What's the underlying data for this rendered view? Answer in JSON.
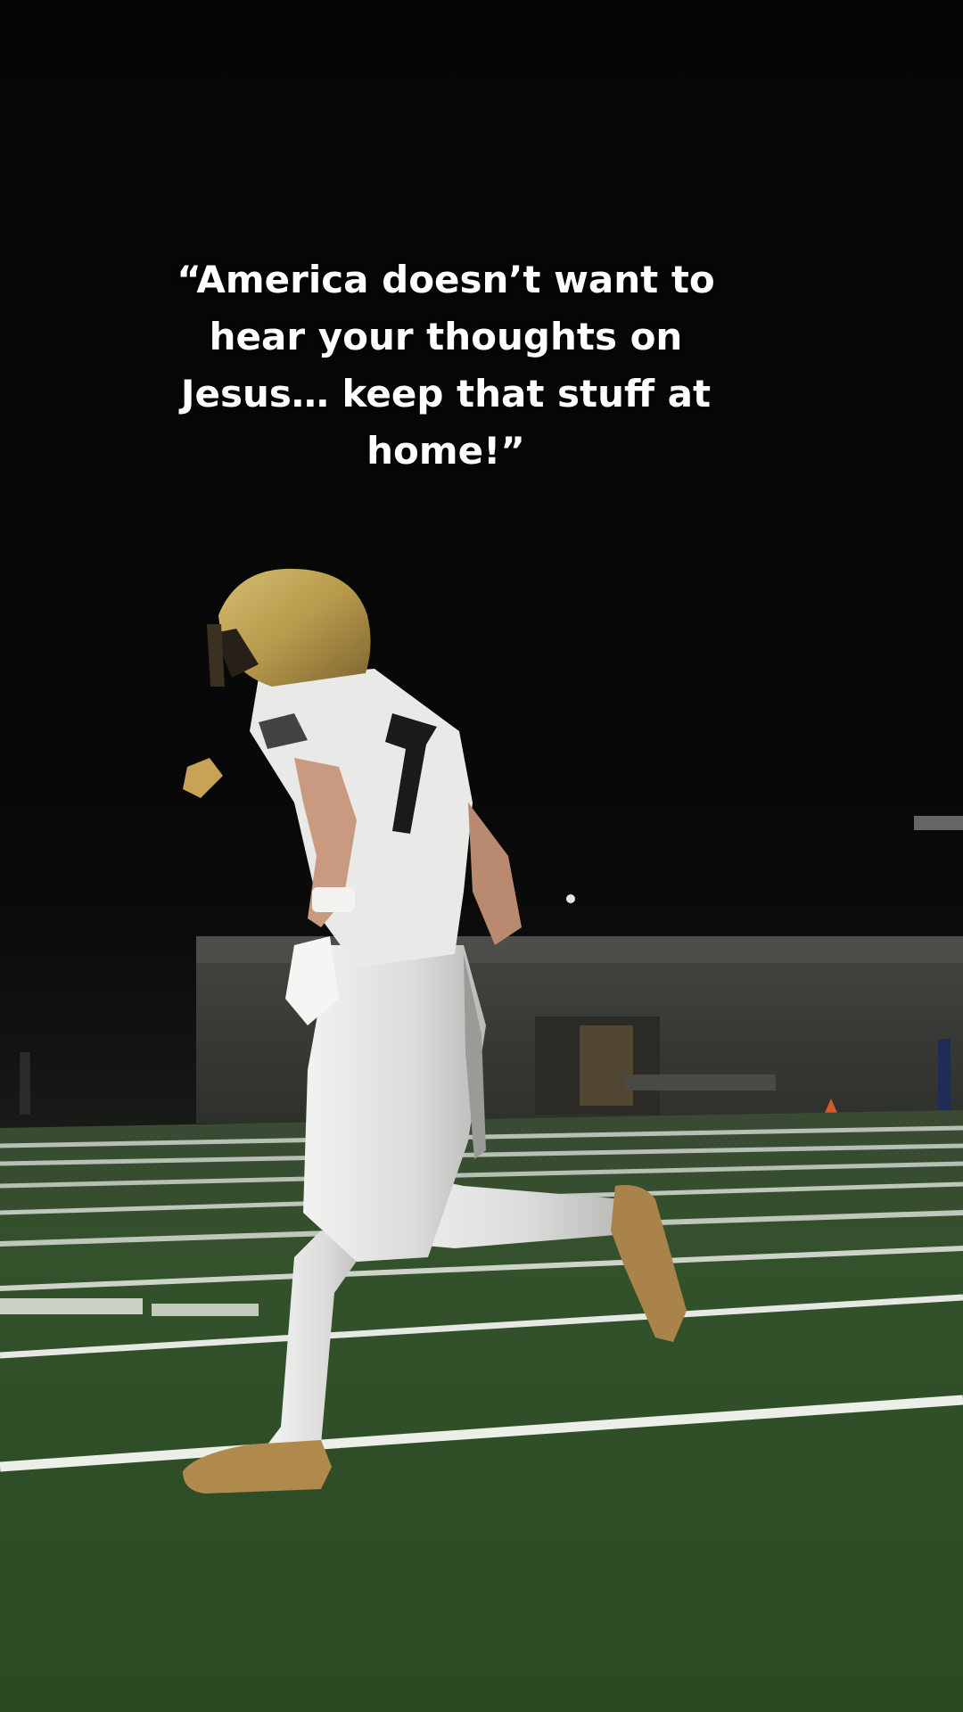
{
  "overlay": {
    "caption": "“America doesn’t want to hear your thoughts on Jesus… keep that stuff at home!”"
  },
  "scene": {
    "subject": "football-player-running",
    "jersey_number": "7",
    "colors": {
      "sky": "#050505",
      "field_green": "#2f4f28",
      "yard_line": "#e9ece6",
      "helmet_gold": "#b79a4c",
      "uniform_white": "#e6e7e4",
      "cleat_gold": "#b08a4c",
      "building": "#3a3b38"
    }
  }
}
